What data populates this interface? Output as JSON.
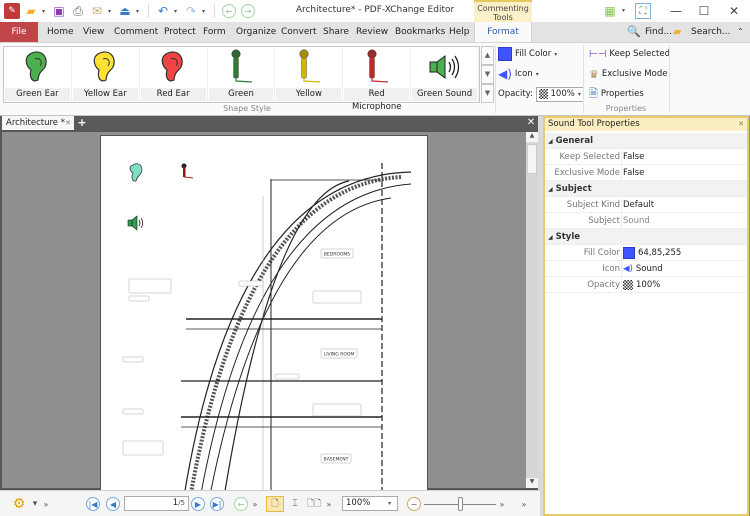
{
  "window": {
    "title": "Architecture* - PDF-XChange Editor",
    "context_tab_group": "Commenting Tools",
    "controls": {
      "minimize": "—",
      "maximize": "☐",
      "close": "✕"
    }
  },
  "quick_access": {
    "icons": [
      "app-logo-icon",
      "open-folder-icon",
      "save-icon",
      "print-icon",
      "email-icon",
      "scan-icon",
      "undo-icon",
      "redo-icon",
      "back-icon",
      "forward-icon"
    ]
  },
  "menu": {
    "file": "File",
    "items": [
      "Home",
      "View",
      "Comment",
      "Protect",
      "Form",
      "Organize",
      "Convert",
      "Share",
      "Review",
      "Bookmarks",
      "Help"
    ],
    "active_tab": "Format",
    "find": "Find...",
    "search": "Search..."
  },
  "ribbon": {
    "gallery": [
      {
        "label": "Green Ear",
        "icon": "ear",
        "color": "#4caf50"
      },
      {
        "label": "Yellow Ear",
        "icon": "ear",
        "color": "#ffe135"
      },
      {
        "label": "Red Ear",
        "icon": "ear",
        "color": "#ef4444"
      },
      {
        "label": "Green",
        "icon": "microphone",
        "color": "#2e7d32"
      },
      {
        "label": "Yellow",
        "icon": "microphone",
        "color": "#d4b800"
      },
      {
        "label": "Red Microphone",
        "icon": "microphone",
        "color": "#c62828"
      },
      {
        "label": "Green Sound",
        "icon": "speaker",
        "color": "#4caf50"
      }
    ],
    "gallery_group_label": "Shape Style",
    "fill_color_label": "Fill Color",
    "fill_color": "#4055ff",
    "icon_label": "Icon",
    "opacity_label": "Opacity:",
    "opacity_value": "100%",
    "keep_selected": "Keep Selected",
    "exclusive_mode": "Exclusive Mode",
    "properties": "Properties",
    "properties_group_label": "Properties"
  },
  "document": {
    "tab_label": "Architecture *",
    "rooms": [
      "BEDROOMS",
      "LIVING ROOM",
      "BASEMENT"
    ]
  },
  "properties_panel": {
    "title": "Sound Tool Properties",
    "sections": [
      {
        "name": "General",
        "rows": [
          {
            "key": "Keep Selected",
            "value": "False"
          },
          {
            "key": "Exclusive Mode",
            "value": "False"
          }
        ]
      },
      {
        "name": "Subject",
        "rows": [
          {
            "key": "Subject Kind",
            "value": "Default"
          },
          {
            "key": "Subject",
            "value": "Sound"
          }
        ]
      },
      {
        "name": "Style",
        "rows": [
          {
            "key": "Fill Color",
            "value": "64,85,255"
          },
          {
            "key": "Icon",
            "value": "Sound"
          },
          {
            "key": "Opacity",
            "value": "100%"
          }
        ]
      }
    ]
  },
  "statusbar": {
    "page_current": "1",
    "page_total": "/5",
    "zoom": "100%"
  }
}
